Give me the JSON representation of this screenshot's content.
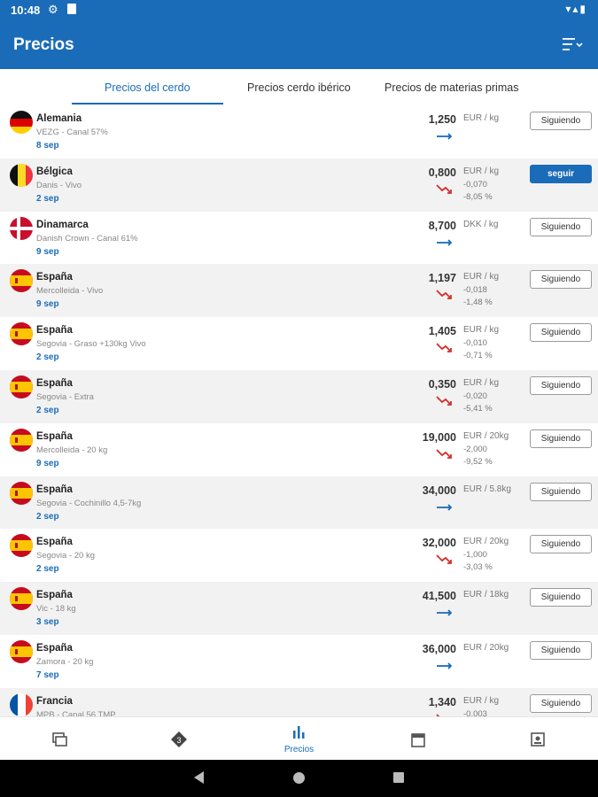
{
  "status_bar": {
    "time": "10:48"
  },
  "app_bar": {
    "title": "Precios"
  },
  "tabs": [
    {
      "label": "Precios del cerdo",
      "active": true
    },
    {
      "label": "Precios cerdo ibérico",
      "active": false
    },
    {
      "label": "Precios de materias primas",
      "active": false
    }
  ],
  "rows": [
    {
      "country": "Alemania",
      "flag": "de",
      "source": "VEZG - Canal 57%",
      "date": "8 sep",
      "price": "1,250",
      "unit": "EUR / kg",
      "change": "",
      "percent": "",
      "trend": "flat",
      "button": "Siguiendo",
      "following": true
    },
    {
      "country": "Bélgica",
      "flag": "be",
      "source": "Danis - Vivo",
      "date": "2 sep",
      "price": "0,800",
      "unit": "EUR / kg",
      "change": "-0,070",
      "percent": "-8,05 %",
      "trend": "down",
      "button": "seguir",
      "following": false
    },
    {
      "country": "Dinamarca",
      "flag": "dk",
      "source": "Danish Crown - Canal 61%",
      "date": "9 sep",
      "price": "8,700",
      "unit": "DKK / kg",
      "change": "",
      "percent": "",
      "trend": "flat",
      "button": "Siguiendo",
      "following": true
    },
    {
      "country": "España",
      "flag": "es",
      "source": "Mercolleida - Vivo",
      "date": "9 sep",
      "price": "1,197",
      "unit": "EUR / kg",
      "change": "-0,018",
      "percent": "-1,48 %",
      "trend": "down",
      "button": "Siguiendo",
      "following": true
    },
    {
      "country": "España",
      "flag": "es",
      "source": "Segovia - Graso +130kg Vivo",
      "date": "2 sep",
      "price": "1,405",
      "unit": "EUR / kg",
      "change": "-0,010",
      "percent": "-0,71 %",
      "trend": "down",
      "button": "Siguiendo",
      "following": true
    },
    {
      "country": "España",
      "flag": "es",
      "source": "Segovia - Extra",
      "date": "2 sep",
      "price": "0,350",
      "unit": "EUR / kg",
      "change": "-0,020",
      "percent": "-5,41 %",
      "trend": "down",
      "button": "Siguiendo",
      "following": true
    },
    {
      "country": "España",
      "flag": "es",
      "source": "Mercolleida - 20 kg",
      "date": "9 sep",
      "price": "19,000",
      "unit": "EUR / 20kg",
      "change": "-2,000",
      "percent": "-9,52 %",
      "trend": "down",
      "button": "Siguiendo",
      "following": true
    },
    {
      "country": "España",
      "flag": "es",
      "source": "Segovia - Cochinillo 4,5-7kg",
      "date": "2 sep",
      "price": "34,000",
      "unit": "EUR / 5.8kg",
      "change": "",
      "percent": "",
      "trend": "flat",
      "button": "Siguiendo",
      "following": true
    },
    {
      "country": "España",
      "flag": "es",
      "source": "Segovia - 20 kg",
      "date": "2 sep",
      "price": "32,000",
      "unit": "EUR / 20kg",
      "change": "-1,000",
      "percent": "-3,03 %",
      "trend": "down",
      "button": "Siguiendo",
      "following": true
    },
    {
      "country": "España",
      "flag": "es",
      "source": "Vic - 18 kg",
      "date": "3 sep",
      "price": "41,500",
      "unit": "EUR / 18kg",
      "change": "",
      "percent": "",
      "trend": "flat",
      "button": "Siguiendo",
      "following": true
    },
    {
      "country": "España",
      "flag": "es",
      "source": "Zamora - 20 kg",
      "date": "7 sep",
      "price": "36,000",
      "unit": "EUR / 20kg",
      "change": "",
      "percent": "",
      "trend": "flat",
      "button": "Siguiendo",
      "following": true
    },
    {
      "country": "Francia",
      "flag": "fr",
      "source": "MPB - Canal 56 TMP",
      "date": "",
      "price": "1,340",
      "unit": "EUR / kg",
      "change": "-0,003",
      "percent": "",
      "trend": "down",
      "button": "Siguiendo",
      "following": true
    }
  ],
  "bottom_nav": [
    {
      "icon": "news-icon",
      "label": ""
    },
    {
      "icon": "badge-icon",
      "label": ""
    },
    {
      "icon": "bar-chart-icon",
      "label": "Precios",
      "active": true
    },
    {
      "icon": "calendar-icon",
      "label": ""
    },
    {
      "icon": "contact-icon",
      "label": ""
    }
  ],
  "colors": {
    "primary": "#1a6cb8",
    "down_trend": "#d32f2f",
    "flat_trend": "#1a6cb8"
  }
}
